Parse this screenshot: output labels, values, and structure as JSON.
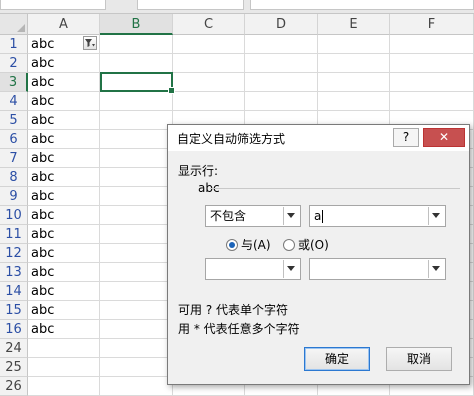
{
  "spreadsheet": {
    "columns": [
      "A",
      "B",
      "C",
      "D",
      "E",
      "F"
    ],
    "selected_column": "B",
    "rows": [
      {
        "num": "1",
        "a": "abc"
      },
      {
        "num": "2",
        "a": "abc"
      },
      {
        "num": "3",
        "a": "abc"
      },
      {
        "num": "4",
        "a": "abc"
      },
      {
        "num": "5",
        "a": "abc"
      },
      {
        "num": "6",
        "a": "abc"
      },
      {
        "num": "7",
        "a": "abc"
      },
      {
        "num": "8",
        "a": "abc"
      },
      {
        "num": "9",
        "a": "abc"
      },
      {
        "num": "10",
        "a": "abc"
      },
      {
        "num": "11",
        "a": "abc"
      },
      {
        "num": "12",
        "a": "abc"
      },
      {
        "num": "13",
        "a": "abc"
      },
      {
        "num": "14",
        "a": "abc"
      },
      {
        "num": "15",
        "a": "abc"
      },
      {
        "num": "16",
        "a": "abc"
      },
      {
        "num": "24",
        "a": ""
      },
      {
        "num": "25",
        "a": ""
      },
      {
        "num": "26",
        "a": ""
      }
    ],
    "active_cell": "B3",
    "colors": {
      "accent": "#217346",
      "filtered_row_number": "#2c4fa5"
    }
  },
  "dialog": {
    "title": "自定义自动筛选方式",
    "help_label": "?",
    "close_label": "✕",
    "show_rows_label": "显示行:",
    "field_name": "abc",
    "condition1": {
      "operator": "不包含",
      "value": "a"
    },
    "logic": {
      "and_label": "与(A)",
      "or_label": "或(O)",
      "selected": "and"
    },
    "condition2": {
      "operator": "",
      "value": ""
    },
    "hint1": "可用 ? 代表单个字符",
    "hint2": "用 * 代表任意多个字符",
    "ok_label": "确定",
    "cancel_label": "取消"
  }
}
